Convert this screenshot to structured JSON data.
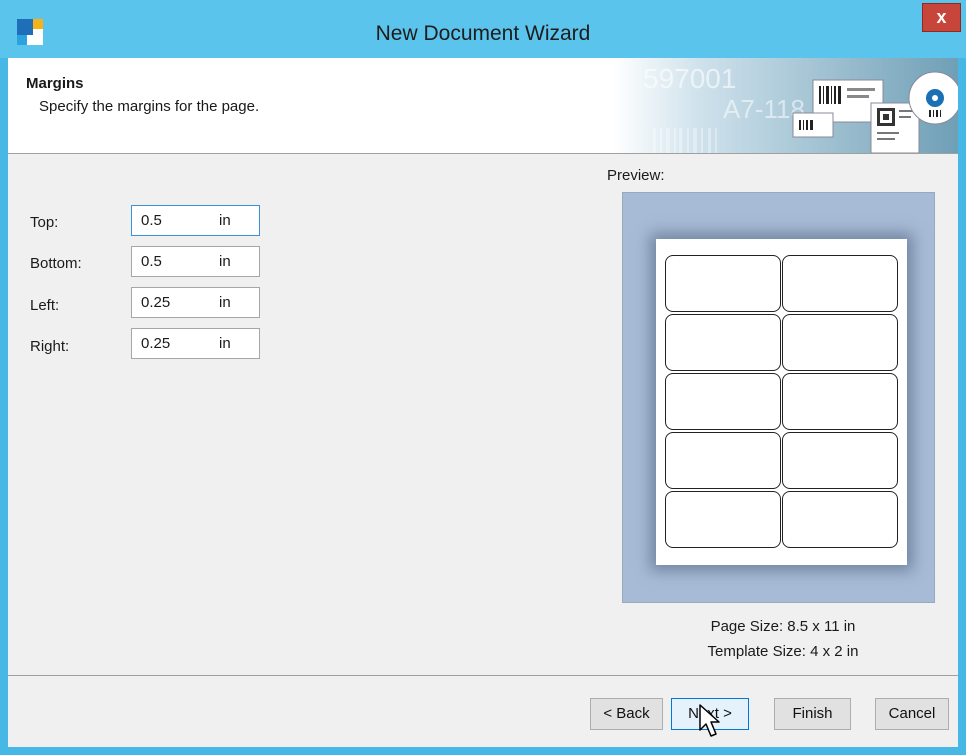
{
  "window": {
    "title": "New Document Wizard",
    "close_label": "x"
  },
  "header": {
    "title": "Margins",
    "subtitle": "Specify the margins for the page.",
    "banner_text_1": "597001",
    "banner_text_2": "A7-118"
  },
  "fields": [
    {
      "label": "Top:",
      "value": "0.5",
      "unit": "in"
    },
    {
      "label": "Bottom:",
      "value": "0.5",
      "unit": "in"
    },
    {
      "label": "Left:",
      "value": "0.25",
      "unit": "in"
    },
    {
      "label": "Right:",
      "value": "0.25",
      "unit": "in"
    }
  ],
  "preview": {
    "label": "Preview:",
    "page_size": "Page Size:  8.5 x 11 in",
    "template_size": "Template Size:  4 x 2 in",
    "label_rows": 5,
    "label_cols": 2
  },
  "buttons": {
    "back": "< Back",
    "next": "Next >",
    "finish": "Finish",
    "cancel": "Cancel"
  },
  "colors": {
    "titlebar": "#5bc4ec",
    "close_button": "#c8453b",
    "preview_background": "#a8bbd6",
    "focus_border": "#0078d7"
  },
  "icons": {
    "app": "app-logo-icon",
    "close": "close-icon",
    "cursor": "mouse-pointer-icon"
  }
}
